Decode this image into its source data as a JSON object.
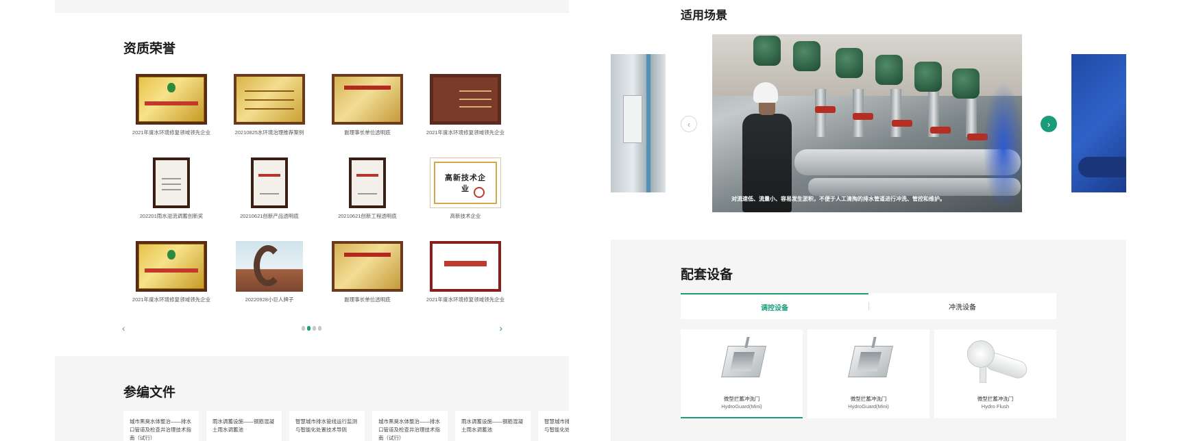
{
  "honors": {
    "title": "资质荣誉",
    "items": [
      {
        "caption": "2021年度水环境修复领域领先企业",
        "style": "gold"
      },
      {
        "caption": "20210825水环境治理推荐案例",
        "style": "gold2"
      },
      {
        "caption": "副理事长单位透明底",
        "style": "red-gold"
      },
      {
        "caption": "2021年度水环境修复领域领先企业",
        "style": "brown"
      },
      {
        "caption": "202201雨水溢流调蓄创新奖",
        "style": "plaque"
      },
      {
        "caption": "20210621创新产品透明底",
        "style": "plaque"
      },
      {
        "caption": "20210621创新工程透明底",
        "style": "plaque"
      },
      {
        "caption": "高新技术企业",
        "style": "white",
        "cert_title": "高新技术企业"
      },
      {
        "caption": "2021年度水环境修复领域领先企业",
        "style": "gold"
      },
      {
        "caption": "20220928小巨人牌子",
        "style": "photo"
      },
      {
        "caption": "副理事长单位透明底",
        "style": "red-gold"
      },
      {
        "caption": "2021年度水环境修复领域领先企业",
        "style": "red-frame"
      }
    ],
    "pager": {
      "prev": "‹",
      "next": "›",
      "dots": 4,
      "active": 1
    }
  },
  "references": {
    "title": "参编文件",
    "cards": [
      "城市黑臭水体整治——排水口管道及检查井治理技术指南（试行）",
      "雨水调蓄设施——钢筋混凝土雨水调蓄池",
      "智慧城市排水管线运行监测与智能化处置技术导则",
      "城市黑臭水体整治——排水口管道及检查井治理技术指南（试行）",
      "雨水调蓄设施——钢筋混凝土雨水调蓄池",
      "智慧城市排水管线运行监测与智能化处置技术导则"
    ]
  },
  "scenes": {
    "title": "适用场景",
    "caption": "对流速低、流量小、容易发生淤积，不便于人工清掏的排水管道进行冲洗、管控和维护。",
    "prev": "‹",
    "next": "›"
  },
  "equipment": {
    "title": "配套设备",
    "tabs": [
      "调控设备",
      "冲洗设备"
    ],
    "active_tab": 0,
    "products": [
      {
        "name": "微型拦蓄冲洗门",
        "model": "HydroGuard(Mini)",
        "kind": "gate"
      },
      {
        "name": "微型拦蓄冲洗门",
        "model": "HydroGuard(Mini)",
        "kind": "gate"
      },
      {
        "name": "微型拦蓄冲洗门",
        "model": "Hydro Flush",
        "kind": "flush"
      }
    ]
  },
  "colors": {
    "accent": "#1a9c7c",
    "panel": "#f5f5f5"
  }
}
